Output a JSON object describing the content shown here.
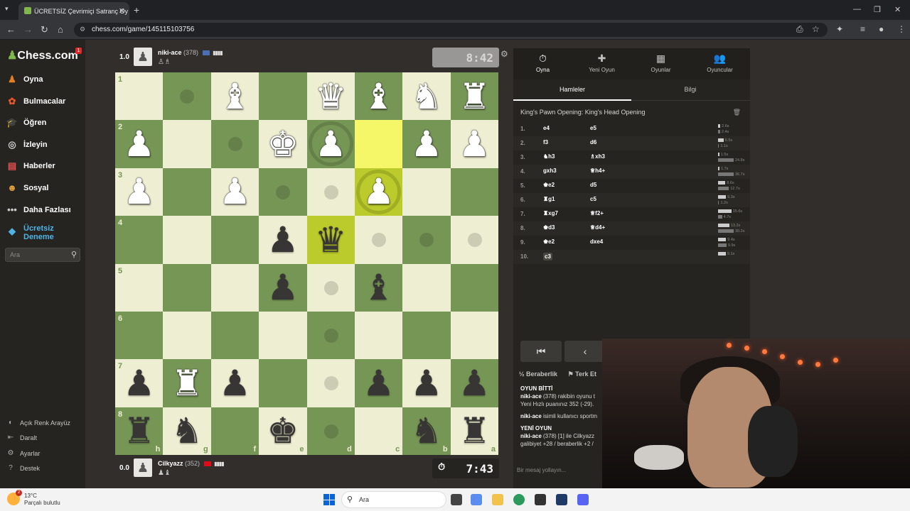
{
  "browser": {
    "tab_title": "ÜCRETSİZ Çevrimiçi Satranç Oy",
    "url": "chess.com/game/145115103756"
  },
  "sidebar": {
    "logo": "Chess.com",
    "notif": "1",
    "items": [
      {
        "label": "Oyna",
        "icon": "pawn-icon",
        "color": "#e67e22"
      },
      {
        "label": "Bulmacalar",
        "icon": "puzzle-icon",
        "color": "#e8552b"
      },
      {
        "label": "Öğren",
        "icon": "learn-icon",
        "color": "#2fa0d8"
      },
      {
        "label": "İzleyin",
        "icon": "binoculars-icon",
        "color": "#cccccc"
      },
      {
        "label": "Haberler",
        "icon": "news-icon",
        "color": "#e05050"
      },
      {
        "label": "Sosyal",
        "icon": "social-icon",
        "color": "#e6a23c"
      },
      {
        "label": "Daha Fazlası",
        "icon": "more-icon",
        "color": "#cccccc"
      }
    ],
    "trial_label": "Ücretsiz Deneme",
    "search_placeholder": "Ara",
    "bottom": [
      {
        "label": "Açık Renk Arayüz",
        "icon": "theme-icon"
      },
      {
        "label": "Daralt",
        "icon": "collapse-icon"
      },
      {
        "label": "Ayarlar",
        "icon": "gear-icon"
      },
      {
        "label": "Destek",
        "icon": "help-icon"
      }
    ]
  },
  "top_player": {
    "score": "1.0",
    "name": "niki-ace",
    "rating": "(378)",
    "clock": "8:42"
  },
  "bottom_player": {
    "score": "0.0",
    "name": "Cilkyazz",
    "rating": "(352)",
    "clock": "7:43"
  },
  "board": {
    "ranks": [
      "1",
      "2",
      "3",
      "4",
      "5",
      "6",
      "7",
      "8"
    ],
    "files": [
      "h",
      "g",
      "f",
      "e",
      "d",
      "c",
      "b",
      "a"
    ],
    "light_color": "#eeeed2",
    "dark_color": "#769656",
    "pieces": [
      {
        "sq": [
          0,
          2
        ],
        "glyph": "♝",
        "c": "w"
      },
      {
        "sq": [
          0,
          4
        ],
        "glyph": "♛",
        "c": "w"
      },
      {
        "sq": [
          0,
          5
        ],
        "glyph": "♝",
        "c": "w"
      },
      {
        "sq": [
          0,
          6
        ],
        "glyph": "♞",
        "c": "w"
      },
      {
        "sq": [
          0,
          7
        ],
        "glyph": "♜",
        "c": "w"
      },
      {
        "sq": [
          1,
          0
        ],
        "glyph": "♟",
        "c": "w"
      },
      {
        "sq": [
          1,
          3
        ],
        "glyph": "♚",
        "c": "w"
      },
      {
        "sq": [
          1,
          4
        ],
        "glyph": "♟",
        "c": "w"
      },
      {
        "sq": [
          1,
          6
        ],
        "glyph": "♟",
        "c": "w"
      },
      {
        "sq": [
          1,
          7
        ],
        "glyph": "♟",
        "c": "w"
      },
      {
        "sq": [
          2,
          0
        ],
        "glyph": "♟",
        "c": "w"
      },
      {
        "sq": [
          2,
          2
        ],
        "glyph": "♟",
        "c": "w"
      },
      {
        "sq": [
          2,
          5
        ],
        "glyph": "♟",
        "c": "w"
      },
      {
        "sq": [
          3,
          3
        ],
        "glyph": "♟",
        "c": "b"
      },
      {
        "sq": [
          3,
          4
        ],
        "glyph": "♛",
        "c": "b"
      },
      {
        "sq": [
          4,
          3
        ],
        "glyph": "♟",
        "c": "b"
      },
      {
        "sq": [
          4,
          5
        ],
        "glyph": "♝",
        "c": "b"
      },
      {
        "sq": [
          6,
          0
        ],
        "glyph": "♟",
        "c": "b"
      },
      {
        "sq": [
          6,
          1
        ],
        "glyph": "♜",
        "c": "w"
      },
      {
        "sq": [
          6,
          2
        ],
        "glyph": "♟",
        "c": "b"
      },
      {
        "sq": [
          6,
          5
        ],
        "glyph": "♟",
        "c": "b"
      },
      {
        "sq": [
          6,
          6
        ],
        "glyph": "♟",
        "c": "b"
      },
      {
        "sq": [
          6,
          7
        ],
        "glyph": "♟",
        "c": "b"
      },
      {
        "sq": [
          7,
          0
        ],
        "glyph": "♜",
        "c": "b"
      },
      {
        "sq": [
          7,
          1
        ],
        "glyph": "♞",
        "c": "b"
      },
      {
        "sq": [
          7,
          3
        ],
        "glyph": "♚",
        "c": "b"
      },
      {
        "sq": [
          7,
          6
        ],
        "glyph": "♞",
        "c": "b"
      },
      {
        "sq": [
          7,
          7
        ],
        "glyph": "♜",
        "c": "b"
      }
    ],
    "dots": [
      [
        0,
        1
      ],
      [
        1,
        2
      ],
      [
        2,
        3
      ],
      [
        2,
        4
      ],
      [
        3,
        5
      ],
      [
        3,
        6
      ],
      [
        3,
        7
      ],
      [
        4,
        4
      ],
      [
        5,
        4
      ],
      [
        6,
        4
      ],
      [
        7,
        4
      ]
    ],
    "rings": [
      [
        1,
        4
      ],
      [
        2,
        5
      ]
    ],
    "highlight": [
      [
        1,
        5
      ],
      [
        2,
        5
      ],
      [
        3,
        4
      ]
    ]
  },
  "panel": {
    "tabs": [
      {
        "label": "Oyna",
        "icon": "clock-icon",
        "glyph": "⏱"
      },
      {
        "label": "Yeni Oyun",
        "icon": "plus-icon",
        "glyph": "✚"
      },
      {
        "label": "Oyunlar",
        "icon": "board-icon",
        "glyph": "▦"
      },
      {
        "label": "Oyuncular",
        "icon": "players-icon",
        "glyph": "👥"
      }
    ],
    "subtabs": [
      "Hamleler",
      "Bilgi"
    ],
    "opening": "King's Pawn Opening: King's Head Opening",
    "moves": [
      {
        "n": "1.",
        "w": "e4",
        "b": "e5",
        "wt": "2.6s",
        "bt": "2.4s"
      },
      {
        "n": "2.",
        "w": "f3",
        "b": "d6",
        "wt": "6.5s",
        "bt": "1.1s"
      },
      {
        "n": "3.",
        "w": "♞h3",
        "b": "♗xh3",
        "wt": "1.5s",
        "bt": "24.8s"
      },
      {
        "n": "4.",
        "w": "gxh3",
        "b": "♕h4+",
        "wt": "1.7s",
        "bt": "36.7s"
      },
      {
        "n": "5.",
        "w": "♚e2",
        "b": "d5",
        "wt": "8.6s",
        "bt": "12.7s"
      },
      {
        "n": "6.",
        "w": "♜g1",
        "b": "c5",
        "wt": "9.3s",
        "bt": "1.2s"
      },
      {
        "n": "7.",
        "w": "♜xg7",
        "b": "♕f2+",
        "wt": "15.6s",
        "bt": "4.7s"
      },
      {
        "n": "8.",
        "w": "♚d3",
        "b": "♕d4+",
        "wt": "13.2s",
        "bt": "30.2s"
      },
      {
        "n": "9.",
        "w": "♚e2",
        "b": "dxe4",
        "wt": "9.4s",
        "bt": "9.9s"
      },
      {
        "n": "10.",
        "w": "c3",
        "b": "",
        "wt": "9.1s",
        "bt": ""
      }
    ],
    "draw_label": "Beraberlik",
    "resign_label": "Terk Et",
    "chat": [
      {
        "bold": "OYUN BİTTİ",
        "text": ""
      },
      {
        "bold": "niki-ace",
        "text": " (378) rakibin oyunu t"
      },
      {
        "bold": "",
        "text": "Yeni Hızlı puanınız 352 (-29)."
      },
      {
        "bold": "niki-ace",
        "text": " isimli kullanıcı sportm"
      },
      {
        "bold": "YENİ OYUN",
        "text": ""
      },
      {
        "bold": "niki-ace",
        "text": " (378) [1] ile Cilkyazz"
      },
      {
        "bold": "",
        "text": "galibiyet +28 / beraberlik +2 /"
      }
    ],
    "chat_placeholder": "Bir mesaj yollayın..."
  },
  "taskbar": {
    "temp": "13°C",
    "weather": "Parçalı bulutlu",
    "badge": "2",
    "search": "Ara"
  }
}
